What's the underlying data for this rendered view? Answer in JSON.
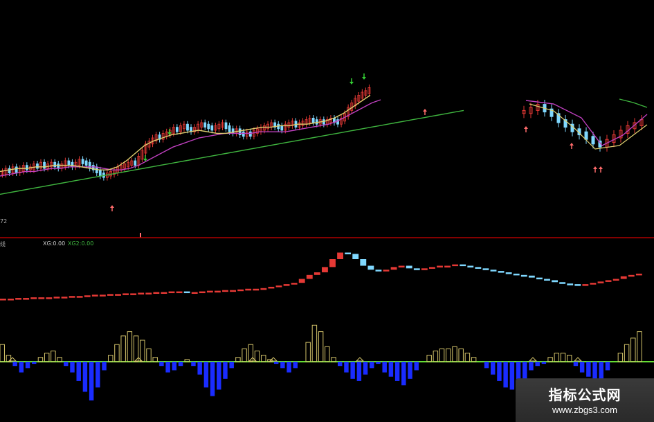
{
  "header": {
    "left_label": "线",
    "xg_label": "XG:0.00",
    "xg2_label": "XG2:0.00",
    "price_label": "72"
  },
  "watermark": {
    "title": "指标公式网",
    "url": "www.zbgs3.com"
  },
  "colors": {
    "background": "#000000",
    "candle_up": "#e53935",
    "candle_down": "#7fd8ff",
    "ma_long": "#3fb53f",
    "ma_mid": "#c040c0",
    "ma_short": "#e0d070",
    "divider": "#b00000",
    "baseline": "#66dd33",
    "osc_up": "#d4c46a",
    "osc_down": "#1a2cff",
    "arrow_buy": "#ff6b6b",
    "arrow_sell": "#33cc33"
  },
  "chart_data": [
    {
      "type": "candlestick",
      "panel": "price",
      "legend": "none",
      "grid": false,
      "ylim": [
        0,
        100
      ],
      "series": [
        {
          "name": "",
          "kind": "candles",
          "values": [
            32,
            34,
            33,
            35,
            33,
            34,
            36,
            35,
            35,
            37,
            36,
            38,
            36,
            37,
            38,
            37,
            36,
            37,
            39,
            38,
            37,
            38,
            40,
            39,
            38,
            36,
            35,
            33,
            31,
            30,
            31,
            32,
            33,
            35,
            36,
            37,
            38,
            39,
            38,
            42,
            46,
            50,
            52,
            54,
            56,
            55,
            57,
            58,
            59,
            61,
            60,
            62,
            63,
            61,
            60,
            61,
            63,
            64,
            63,
            62,
            61,
            62,
            63,
            64,
            62,
            60,
            59,
            60,
            58,
            57,
            58,
            57,
            59,
            60,
            61,
            62,
            63,
            64,
            63,
            62,
            61,
            63,
            64,
            65,
            63,
            64,
            65,
            66,
            67,
            66,
            65,
            66,
            65,
            66,
            67,
            66,
            65,
            67,
            70,
            74,
            77,
            80,
            82,
            84,
            85,
            87
          ]
        },
        {
          "name": "",
          "kind": "line",
          "values": [
            18,
            19,
            20,
            21,
            22,
            23,
            24,
            25,
            26,
            27,
            28,
            29,
            30,
            31,
            32,
            33,
            34,
            35,
            36,
            37,
            38,
            39,
            40,
            41,
            42,
            43,
            44,
            45,
            46,
            47,
            48,
            49,
            50,
            51,
            52,
            53,
            54,
            55,
            56,
            57,
            58,
            59,
            60,
            61,
            62,
            63,
            64,
            65,
            66,
            67,
            68,
            69,
            70,
            71,
            72,
            73
          ]
        },
        {
          "name": "",
          "kind": "line",
          "values": [
            30,
            31,
            32,
            33,
            33,
            34,
            35,
            35,
            36,
            36,
            36,
            36,
            35,
            34,
            34,
            35,
            37,
            40,
            43,
            46,
            49,
            51,
            53,
            55,
            56,
            57,
            58,
            58,
            58,
            58,
            59,
            59,
            59,
            59,
            60,
            61,
            62,
            63,
            64,
            66,
            69,
            72,
            75,
            78,
            80
          ]
        },
        {
          "name": "",
          "kind": "line",
          "values": [
            33,
            34,
            35,
            35,
            36,
            36,
            37,
            37,
            37,
            36,
            35,
            34,
            34,
            36,
            40,
            45,
            50,
            53,
            55,
            57,
            58,
            59,
            60,
            59,
            58,
            58,
            59,
            60,
            61,
            62,
            62,
            63,
            63,
            64,
            64,
            65,
            66,
            68,
            71,
            75,
            79,
            83
          ]
        }
      ],
      "segments": [
        {
          "name": "",
          "values": [
            72,
            74,
            76,
            73,
            70,
            66,
            63,
            60,
            58,
            55,
            52,
            50,
            53,
            56,
            59,
            62,
            64,
            66
          ]
        }
      ],
      "annotations": [
        "buy arrows",
        "sell arrows"
      ]
    },
    {
      "type": "line",
      "panel": "indicator",
      "legend": "none",
      "grid": false,
      "ylim": [
        0,
        100
      ],
      "series": [
        {
          "name": "",
          "kind": "step-dots",
          "values": [
            20,
            20,
            21,
            21,
            22,
            22,
            22,
            23,
            23,
            24,
            24,
            25,
            26,
            26,
            27,
            27,
            28,
            28,
            29,
            29,
            30,
            30,
            31,
            31,
            30,
            30,
            31,
            32,
            32,
            33,
            33,
            34,
            35,
            35,
            36,
            38,
            40,
            42,
            44,
            50,
            56,
            60,
            68,
            80,
            90,
            88,
            80,
            70,
            64,
            62,
            64,
            68,
            70,
            66,
            64,
            66,
            68,
            70,
            70,
            72,
            70,
            68,
            66,
            64,
            62,
            60,
            58,
            56,
            55,
            52,
            50,
            48,
            45,
            43,
            42,
            40,
            42,
            44,
            46,
            48,
            50,
            54,
            56,
            58
          ]
        }
      ]
    },
    {
      "type": "bar",
      "panel": "oscillator",
      "legend": "none",
      "grid": false,
      "ylim": [
        -100,
        100
      ],
      "series": [
        {
          "name": "",
          "kind": "histogram",
          "values": [
            40,
            15,
            -10,
            -25,
            -15,
            -5,
            10,
            20,
            25,
            10,
            -10,
            -25,
            -45,
            -70,
            -90,
            -60,
            -20,
            15,
            40,
            60,
            70,
            60,
            50,
            30,
            10,
            -10,
            -25,
            -20,
            -10,
            5,
            -10,
            -30,
            -60,
            -80,
            -65,
            -40,
            -15,
            10,
            30,
            40,
            25,
            15,
            5,
            -5,
            -15,
            -25,
            -15,
            0,
            45,
            85,
            70,
            35,
            10,
            -10,
            -25,
            -40,
            -45,
            -30,
            -15,
            -5,
            -25,
            -35,
            -45,
            -55,
            -40,
            -20,
            0,
            15,
            25,
            30,
            30,
            35,
            30,
            20,
            10,
            0,
            -15,
            -30,
            -45,
            -60,
            -65,
            -55,
            -40,
            -20,
            -10,
            -5,
            10,
            20,
            20,
            15,
            -10,
            -25,
            -35,
            -45,
            -40,
            -20,
            0,
            20,
            40,
            55,
            70
          ]
        }
      ]
    }
  ]
}
